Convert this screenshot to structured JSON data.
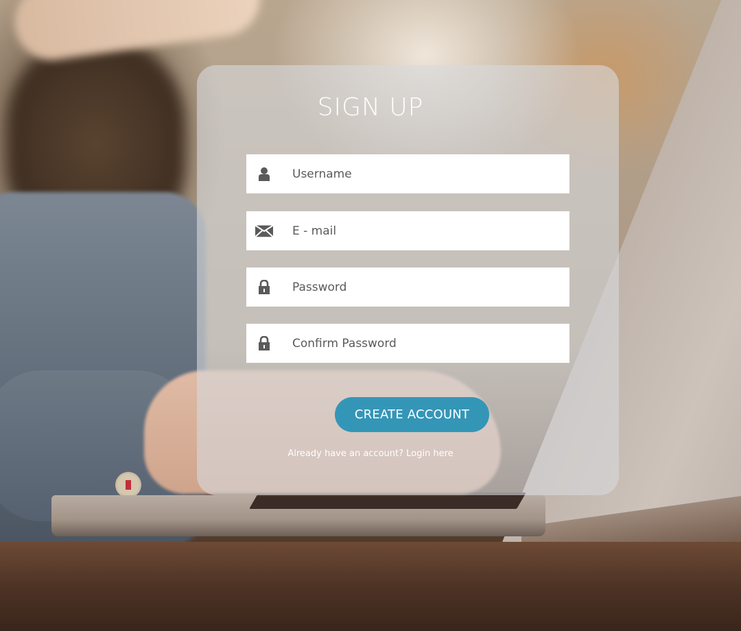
{
  "form": {
    "title": "SIGN UP",
    "fields": [
      {
        "name": "username",
        "icon": "user-icon",
        "placeholder": "Username",
        "value": ""
      },
      {
        "name": "email",
        "icon": "envelope-icon",
        "placeholder": "E - mail",
        "value": ""
      },
      {
        "name": "password",
        "icon": "lock-icon",
        "placeholder": "Password",
        "value": ""
      },
      {
        "name": "confirm_password",
        "icon": "lock-icon",
        "placeholder": "Confirm Password",
        "value": ""
      }
    ],
    "submit_label": "CREATE ACCOUNT",
    "login_prompt": "Already have an account? Login here"
  },
  "colors": {
    "accent": "#1c8eb5",
    "icon": "#5a5a5a",
    "card": "#d6d8dc"
  }
}
